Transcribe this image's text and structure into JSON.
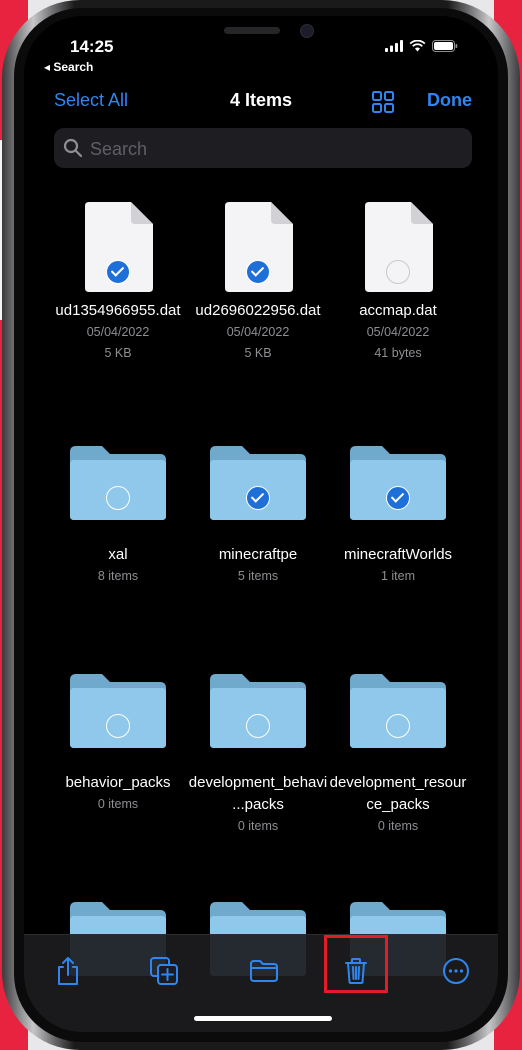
{
  "status_bar": {
    "time": "14:25",
    "back_label": "◂ Search"
  },
  "nav": {
    "select_all": "Select All",
    "title": "4 Items",
    "done": "Done"
  },
  "search": {
    "placeholder": "Search",
    "value": ""
  },
  "files": [
    {
      "kind": "file",
      "name": "ud1354966955.dat",
      "date": "05/04/2022",
      "size": "5 KB",
      "selected": true
    },
    {
      "kind": "file",
      "name": "ud2696022956.dat",
      "date": "05/04/2022",
      "size": "5 KB",
      "selected": true
    },
    {
      "kind": "file",
      "name": "accmap.dat",
      "date": "05/04/2022",
      "size": "41 bytes",
      "selected": false
    },
    {
      "kind": "folder",
      "name": "xal",
      "count": "8 items",
      "selected": false
    },
    {
      "kind": "folder",
      "name": "minecraftpe",
      "count": "5 items",
      "selected": true
    },
    {
      "kind": "folder",
      "name": "minecraftWorlds",
      "count": "1 item",
      "selected": true
    },
    {
      "kind": "folder",
      "name": "behavior_packs",
      "count": "0 items",
      "selected": false
    },
    {
      "kind": "folder",
      "name": "development_behavi...packs",
      "count": "0 items",
      "selected": false
    },
    {
      "kind": "folder",
      "name": "development_resource_packs",
      "count": "0 items",
      "selected": false
    }
  ],
  "toolbar": [
    "share-icon",
    "duplicate-icon",
    "move-folder-icon",
    "trash-icon",
    "more-icon"
  ],
  "colors": {
    "accent": "#2f86f0",
    "folder": "#8fc8ea",
    "highlight": "#e11d2a"
  }
}
